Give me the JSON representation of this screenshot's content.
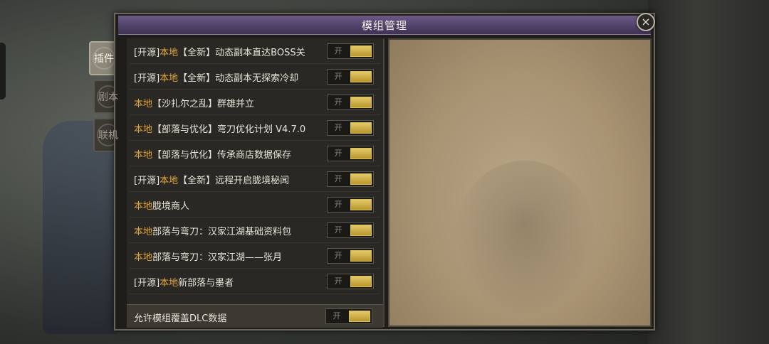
{
  "dialog": {
    "title": "模组管理",
    "close_glyph": "×"
  },
  "side_tabs": [
    {
      "label": "插件",
      "active": true
    },
    {
      "label": "剧本",
      "active": false
    },
    {
      "label": "联机",
      "active": false
    }
  ],
  "mods": [
    {
      "open_tag": "[开源]",
      "local_tag": "本地",
      "name": "【全新】动态副本直达BOSS关",
      "toggle_label": "开",
      "enabled": true
    },
    {
      "open_tag": "[开源]",
      "local_tag": "本地",
      "name": "【全新】动态副本无探索冷却",
      "toggle_label": "开",
      "enabled": true
    },
    {
      "open_tag": "",
      "local_tag": "本地",
      "name": "【沙扎尔之乱】群雄并立",
      "toggle_label": "开",
      "enabled": true
    },
    {
      "open_tag": "",
      "local_tag": "本地",
      "name": "【部落与优化】弯刀优化计划 V4.7.0",
      "toggle_label": "开",
      "enabled": true
    },
    {
      "open_tag": "",
      "local_tag": "本地",
      "name": "【部落与优化】传承商店数据保存",
      "toggle_label": "开",
      "enabled": true
    },
    {
      "open_tag": "[开源]",
      "local_tag": "本地",
      "name": "【全新】远程开启胧境秘闻",
      "toggle_label": "开",
      "enabled": true
    },
    {
      "open_tag": "",
      "local_tag": "本地",
      "name": "胧境商人",
      "toggle_label": "开",
      "enabled": true
    },
    {
      "open_tag": "",
      "local_tag": "本地",
      "name": "部落与弯刀：汉家江湖基础资料包",
      "toggle_label": "开",
      "enabled": true
    },
    {
      "open_tag": "",
      "local_tag": "本地",
      "name": "部落与弯刀：汉家江湖——张月",
      "toggle_label": "开",
      "enabled": true
    },
    {
      "open_tag": "[开源]",
      "local_tag": "本地",
      "name": "新部落与墨者",
      "toggle_label": "开",
      "enabled": true
    }
  ],
  "footer": {
    "label": "允许模组覆盖DLC数据",
    "toggle_label": "开",
    "enabled": true
  },
  "colors": {
    "local_tag": "#e0a63a",
    "toggle_on": "#c9a94a",
    "title_bar": "#5a4b76"
  }
}
